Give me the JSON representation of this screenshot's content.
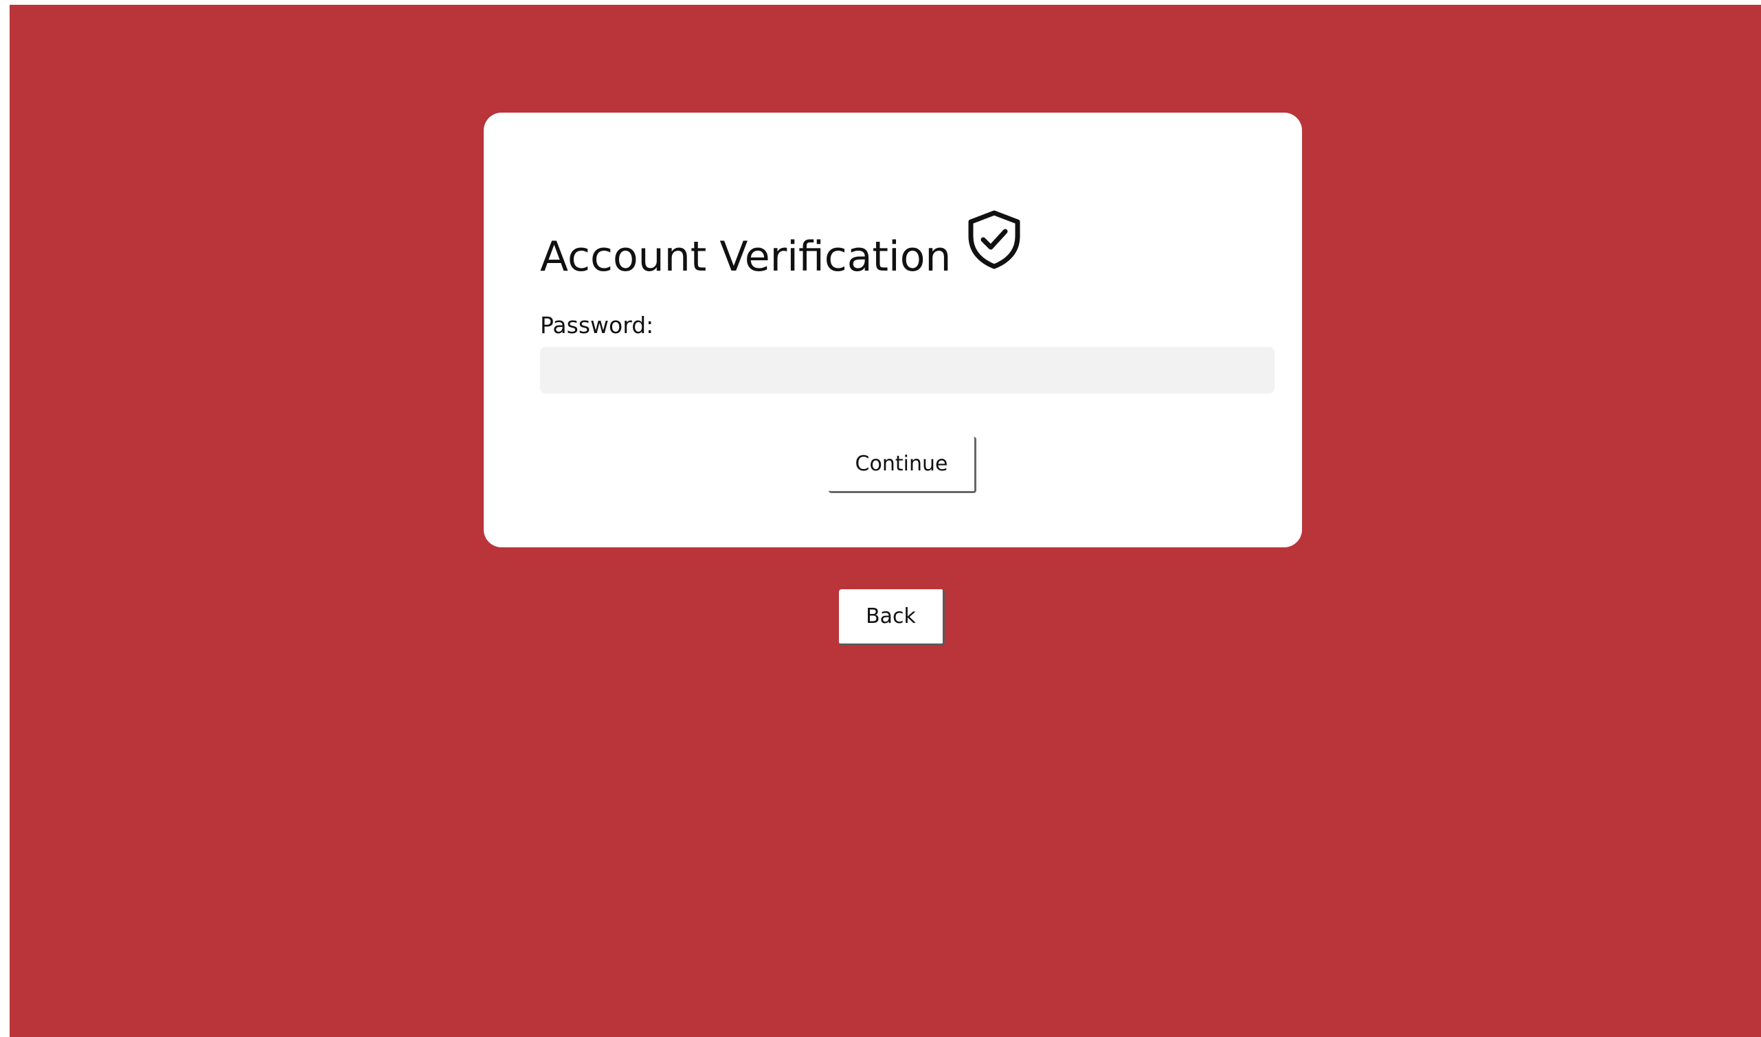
{
  "colors": {
    "background": "#b93539",
    "card": "#ffffff",
    "input_background": "#f2f2f2",
    "text": "#111111"
  },
  "card": {
    "title": "Account Verification",
    "title_icon": "shield-check-icon",
    "password_label": "Password:",
    "password_value": "",
    "continue_label": "Continue"
  },
  "footer": {
    "back_label": "Back"
  }
}
